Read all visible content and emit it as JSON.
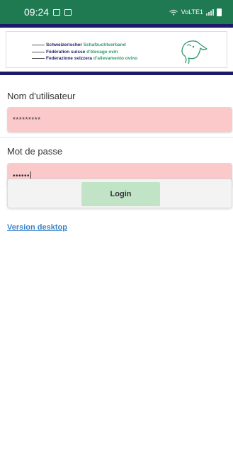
{
  "status_bar": {
    "time": "09:24",
    "left_icons": [
      "image-icon",
      "checkbox-icon"
    ],
    "network_label": "VoLTE1",
    "right_icons": [
      "wifi-icon",
      "signal-icon",
      "battery-icon"
    ],
    "background_color": "#1f7a52"
  },
  "banner": {
    "lines": [
      {
        "part1": "Schweizerischer",
        "part2": "Schafzuchtverband"
      },
      {
        "part1": "Fédération suisse",
        "part2": "d'élevage ovin"
      },
      {
        "part1": "Federazione svizzera",
        "part2": "d'allevamento ovino"
      }
    ],
    "logo_icon": "sheep-head-logo",
    "bar_color": "#1d1a6c",
    "accent_color": "#2b9a6a"
  },
  "form": {
    "username_label": "Nom d'utilisateur",
    "username_value": "*********",
    "password_label": "Mot de passe",
    "password_value": "••••••",
    "field_background": "#fbc9c9"
  },
  "login": {
    "button_label": "Login",
    "button_color": "#c1e3c6"
  },
  "links": {
    "desktop_version": "Version desktop",
    "link_color": "#3a84c9"
  }
}
